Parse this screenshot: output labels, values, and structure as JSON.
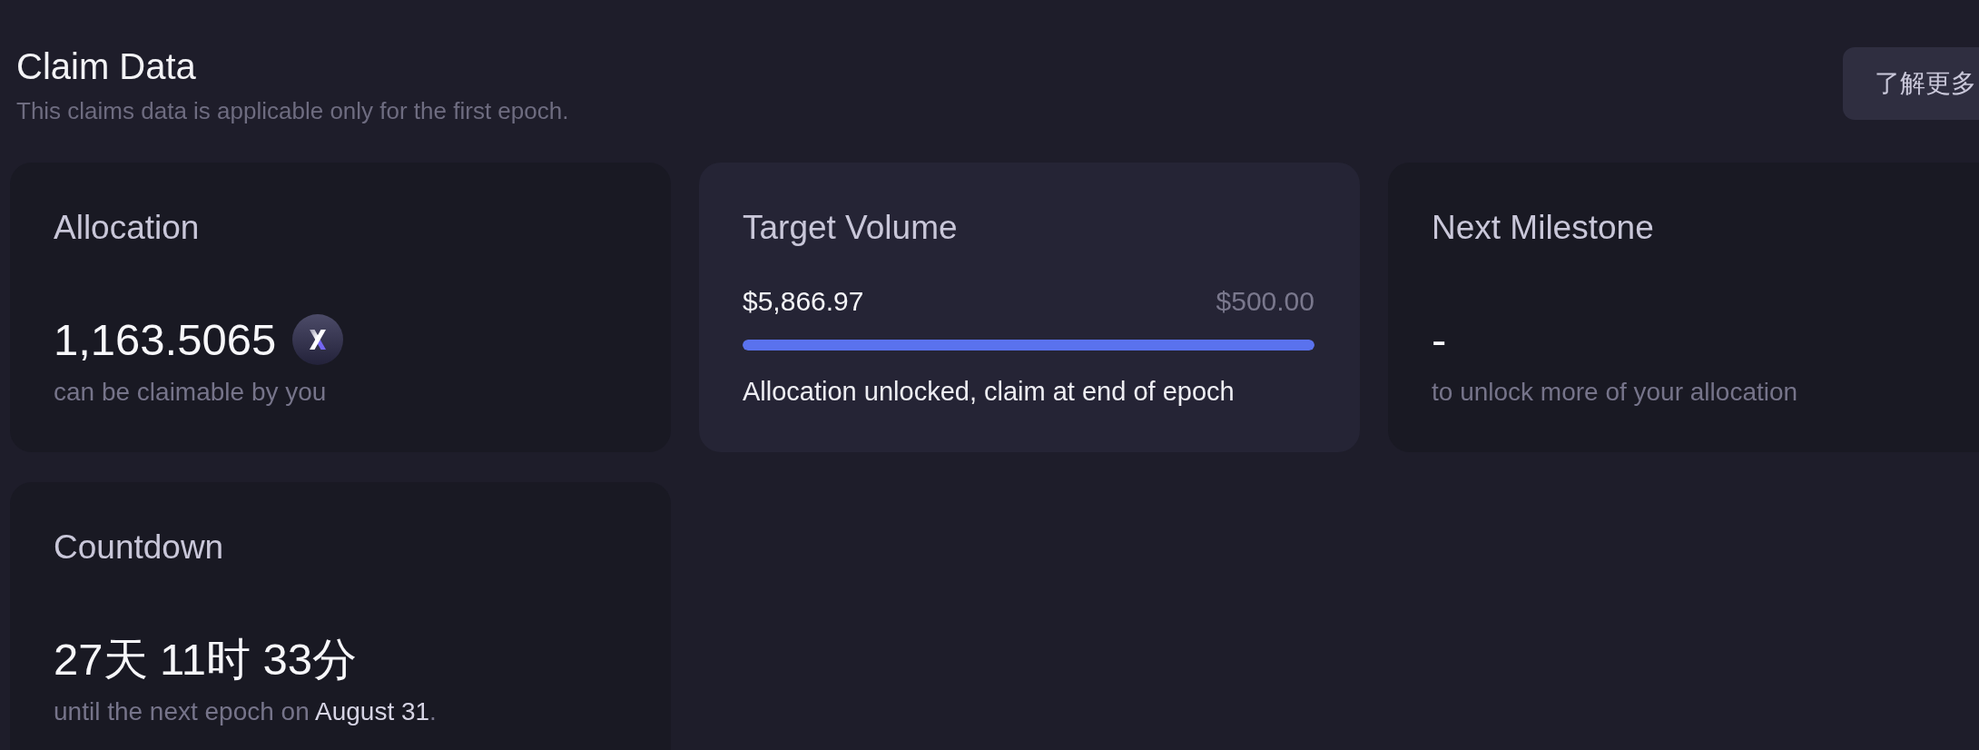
{
  "header": {
    "title": "Claim Data",
    "subtitle": "This claims data is applicable only for the first epoch.",
    "button": "了解更多"
  },
  "cards": [
    {
      "kind": "token",
      "title": "Allocation",
      "value": "1,163.5065",
      "caption": "can be claimable by you"
    },
    {
      "kind": "progress",
      "title": "Target Volume",
      "current": "$5,866.97",
      "target": "$500.00",
      "level": 1,
      "caption": "Allocation unlocked, claim at end of epoch"
    },
    {
      "kind": "stat",
      "title": "Next Milestone",
      "value": "-",
      "caption": "to unlock more of your allocation"
    },
    {
      "kind": "stat",
      "title": "Countdown",
      "value": "27天 11时 33分",
      "caption": "until the next epoch on **August 31**."
    }
  ]
}
